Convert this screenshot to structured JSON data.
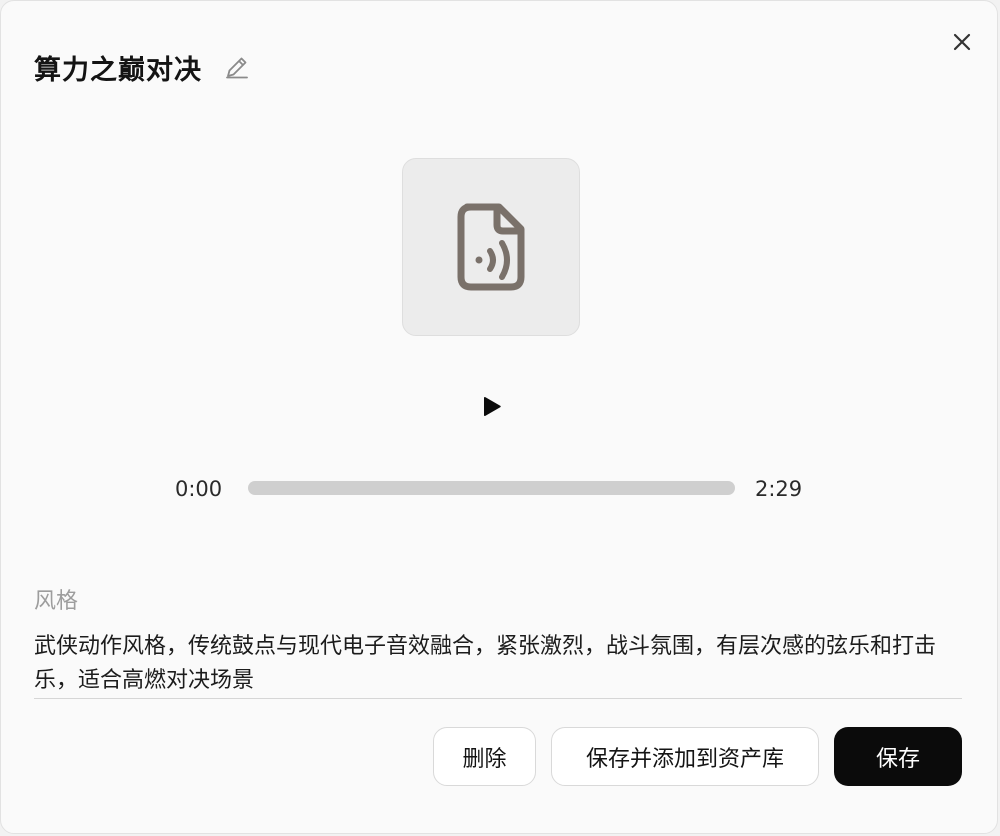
{
  "dialog": {
    "title": "算力之巅对决",
    "close_icon": "close-icon",
    "edit_icon": "pencil-icon"
  },
  "player": {
    "thumbnail_icon": "audio-file-icon",
    "play_icon": "play-icon",
    "current_time": "0:00",
    "total_time": "2:29",
    "progress": 0
  },
  "style": {
    "label": "风格",
    "text": "武侠动作风格，传统鼓点与现代电子音效融合，紧张激烈，战斗氛围，有层次感的弦乐和打击乐，适合高燃对决场景"
  },
  "actions": {
    "delete_label": "删除",
    "save_add_label": "保存并添加到资产库",
    "save_label": "保存"
  },
  "colors": {
    "primary_button": "#0b0b0b",
    "icon": "#7a716a"
  }
}
